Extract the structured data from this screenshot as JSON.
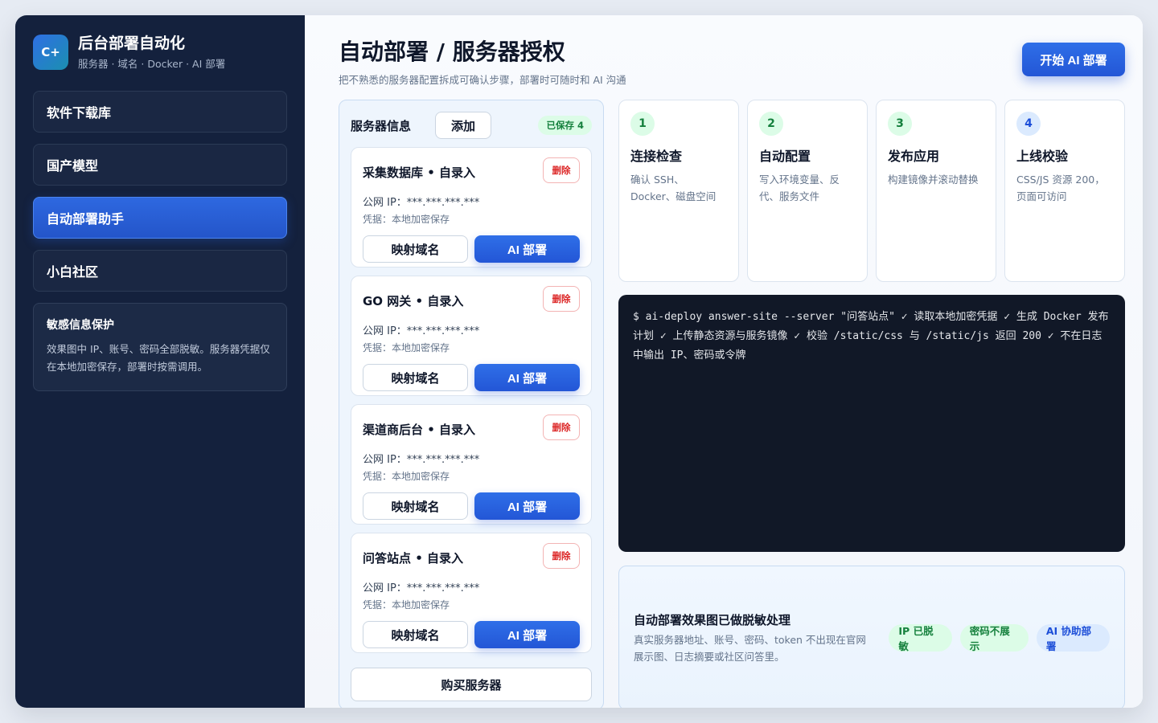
{
  "brand": {
    "logo": "C+",
    "title": "后台部署自动化",
    "subtitle": "服务器 · 域名 · Docker · AI 部署"
  },
  "sidebar": {
    "items": [
      {
        "label": "软件下载库"
      },
      {
        "label": "国产模型"
      },
      {
        "label": "自动部署助手"
      },
      {
        "label": "小白社区"
      }
    ],
    "privacy": {
      "title": "敏感信息保护",
      "text": "效果图中 IP、账号、密码全部脱敏。服务器凭据仅在本地加密保存，部署时按需调用。"
    }
  },
  "header": {
    "title": "自动部署 / 服务器授权",
    "subtitle": "把不熟悉的服务器配置拆成可确认步骤，部署时可随时和 AI 沟通",
    "start_button": "开始 AI 部署"
  },
  "servers": {
    "title": "服务器信息",
    "add_label": "添加",
    "saved_badge": "已保存 4",
    "buy_label": "购买服务器",
    "items": [
      {
        "name": "采集数据库 • 自录入",
        "delete": "删除",
        "ip": "公网 IP：***.***.***.***",
        "cred": "凭据：本地加密保存",
        "map": "映射域名",
        "ai": "AI 部署"
      },
      {
        "name": "GO 网关 • 自录入",
        "delete": "删除",
        "ip": "公网 IP：***.***.***.***",
        "cred": "凭据：本地加密保存",
        "map": "映射域名",
        "ai": "AI 部署"
      },
      {
        "name": "渠道商后台 • 自录入",
        "delete": "删除",
        "ip": "公网 IP：***.***.***.***",
        "cred": "凭据：本地加密保存",
        "map": "映射域名",
        "ai": "AI 部署"
      },
      {
        "name": "问答站点 • 自录入",
        "delete": "删除",
        "ip": "公网 IP：***.***.***.***",
        "cred": "凭据：本地加密保存",
        "map": "映射域名",
        "ai": "AI 部署"
      }
    ]
  },
  "steps": [
    {
      "num": "1",
      "title": "连接检查",
      "desc": "确认 SSH、Docker、磁盘空间"
    },
    {
      "num": "2",
      "title": "自动配置",
      "desc": "写入环境变量、反代、服务文件"
    },
    {
      "num": "3",
      "title": "发布应用",
      "desc": "构建镜像并滚动替换"
    },
    {
      "num": "4",
      "title": "上线校验",
      "desc": "CSS/JS 资源 200，页面可访问"
    }
  ],
  "terminal": {
    "text": "$ ai-deploy answer-site --server \"问答站点\" ✓ 读取本地加密凭据 ✓ 生成 Docker 发布计划 ✓ 上传静态资源与服务镜像 ✓ 校验 /static/css 与 /static/js 返回 200 ✓ 不在日志中输出 IP、密码或令牌"
  },
  "summary": {
    "title": "自动部署效果图已做脱敏处理",
    "desc": "真实服务器地址、账号、密码、token 不出现在官网展示图、日志摘要或社区问答里。",
    "tags": [
      "IP 已脱敏",
      "密码不展示",
      "AI 协助部署"
    ]
  },
  "colors": {
    "primary": "#2356d6",
    "sidebar_bg": "#14213d",
    "success": "#15803d",
    "danger": "#dc2626"
  }
}
